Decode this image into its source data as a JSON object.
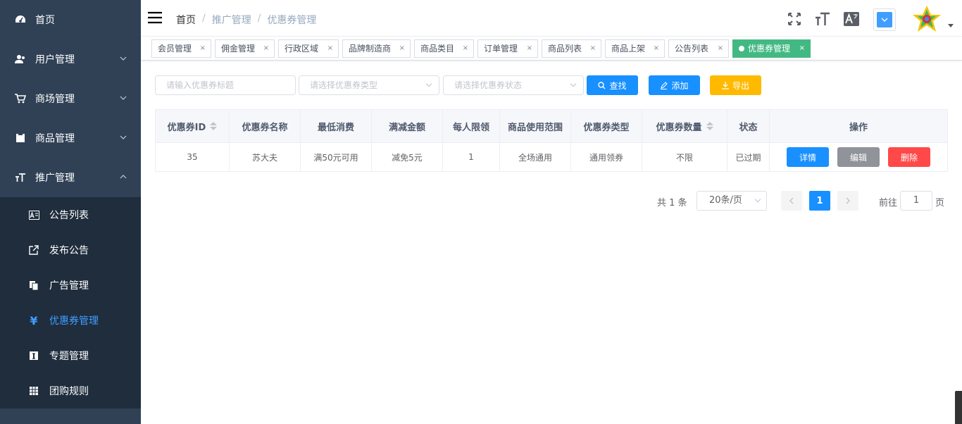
{
  "sidebar": {
    "items": [
      {
        "label": "首页",
        "icon": "dashboard-icon"
      },
      {
        "label": "用户管理",
        "icon": "users-icon"
      },
      {
        "label": "商场管理",
        "icon": "cart-icon"
      },
      {
        "label": "商品管理",
        "icon": "clipboard-icon"
      },
      {
        "label": "推广管理",
        "icon": "text-size-icon"
      }
    ],
    "subitems": [
      {
        "label": "公告列表",
        "icon": "notice-icon"
      },
      {
        "label": "发布公告",
        "icon": "external-link-icon"
      },
      {
        "label": "广告管理",
        "icon": "copy-icon"
      },
      {
        "label": "优惠券管理",
        "icon": "yen-icon"
      },
      {
        "label": "专题管理",
        "icon": "info-box-icon"
      },
      {
        "label": "团购规则",
        "icon": "grid-icon"
      }
    ]
  },
  "breadcrumb": {
    "home": "首页",
    "level1": "推广管理",
    "level2": "优惠券管理"
  },
  "tags": [
    {
      "label": "会员管理"
    },
    {
      "label": "佣金管理"
    },
    {
      "label": "行政区域"
    },
    {
      "label": "品牌制造商"
    },
    {
      "label": "商品类目"
    },
    {
      "label": "订单管理"
    },
    {
      "label": "商品列表"
    },
    {
      "label": "商品上架"
    },
    {
      "label": "公告列表"
    },
    {
      "label": "优惠券管理"
    }
  ],
  "filters": {
    "title_placeholder": "请输入优惠券标题",
    "type_placeholder": "请选择优惠券类型",
    "status_placeholder": "请选择优惠券状态",
    "search_label": "查找",
    "add_label": "添加",
    "export_label": "导出"
  },
  "table": {
    "headers": [
      "优惠券ID",
      "优惠券名称",
      "最低消费",
      "满减金额",
      "每人限领",
      "商品使用范围",
      "优惠券类型",
      "优惠券数量",
      "状态",
      "操作"
    ],
    "rows": [
      {
        "id": "35",
        "name": "苏大夫",
        "min": "满50元可用",
        "discount": "减免5元",
        "limit": "1",
        "scope": "全场通用",
        "type": "通用领券",
        "count": "不限",
        "status": "已过期"
      }
    ],
    "actions": {
      "detail": "详情",
      "edit": "编辑",
      "delete": "删除"
    }
  },
  "pagination": {
    "total": "共 1 条",
    "size": "20条/页",
    "current": "1",
    "goto": "前往",
    "goto_value": "1",
    "page": "页"
  },
  "colors": {
    "sidebar": "#304156",
    "primary": "#1890ff",
    "warning": "#ffba00",
    "danger": "#ff4949",
    "info": "#909399",
    "tag_active": "#42b983"
  }
}
